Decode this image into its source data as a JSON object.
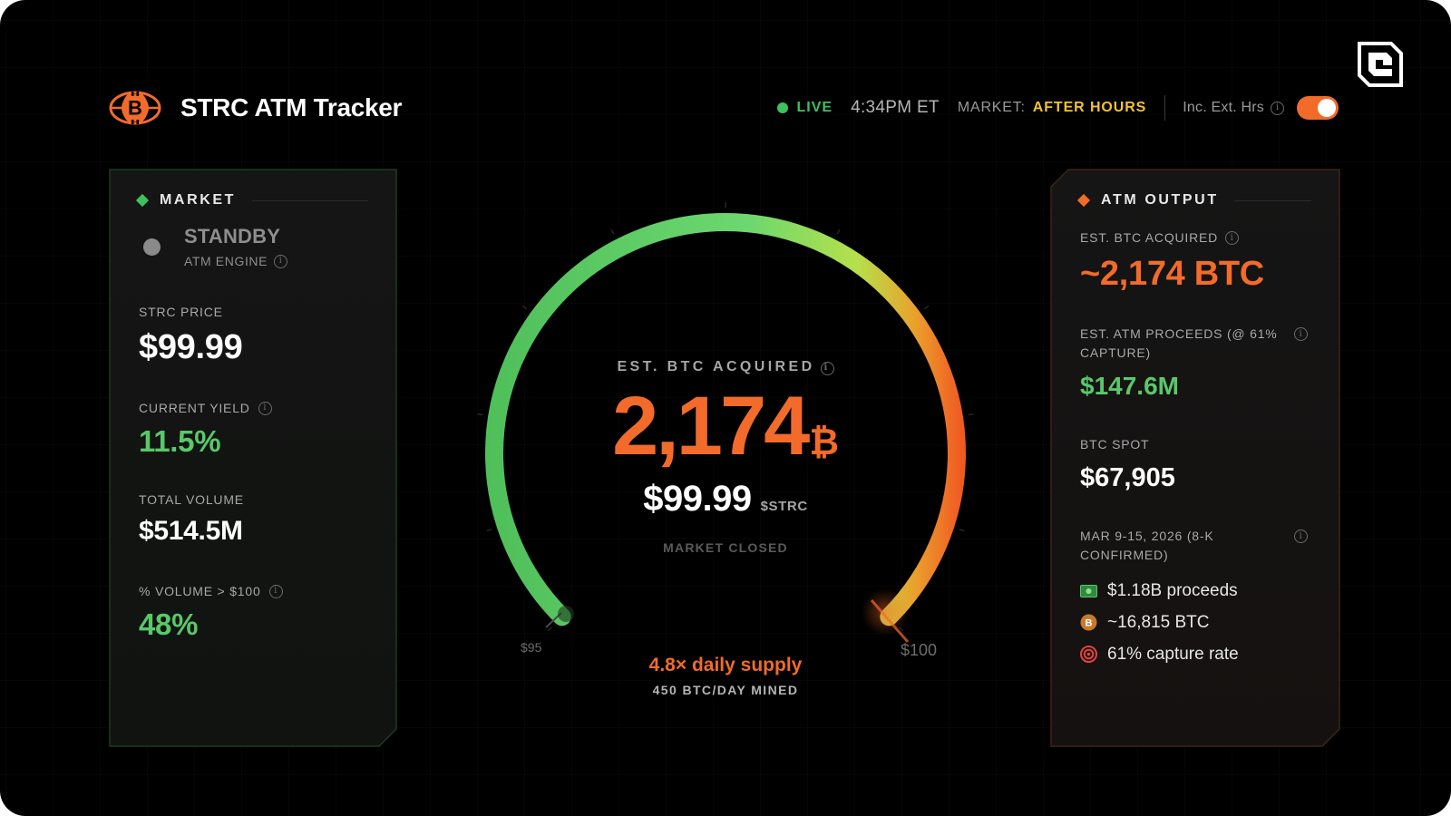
{
  "header": {
    "title": "STRC ATM Tracker",
    "live_label": "LIVE",
    "time": "4:34PM ET",
    "market_label": "MARKET:",
    "market_state": "AFTER HOURS",
    "ext_hours_label": "Inc. Ext. Hrs",
    "ext_hours_enabled": true
  },
  "left_panel": {
    "heading": "MARKET",
    "engine_state": "STANDBY",
    "engine_label": "ATM ENGINE",
    "metrics": [
      {
        "label": "STRC PRICE",
        "value": "$99.99"
      },
      {
        "label": "CURRENT YIELD",
        "value": "11.5%"
      },
      {
        "label": "TOTAL VOLUME",
        "value": "$514.5M"
      },
      {
        "label": "% VOLUME > $100",
        "value": "48%"
      }
    ]
  },
  "gauge": {
    "label": "EST. BTC ACQUIRED",
    "value": "2,174",
    "unit": "₿",
    "price": "$99.99",
    "ticker": "$STRC",
    "status": "MARKET CLOSED",
    "min_label": "$95",
    "max_label": "$100",
    "fill_fraction": 1.0,
    "supply_text": "4.8× daily supply",
    "mined_text": "450 BTC/DAY MINED"
  },
  "right_panel": {
    "heading": "ATM OUTPUT",
    "btc_label": "EST. BTC ACQUIRED",
    "btc_value": "~2,174 BTC",
    "proceeds_label": "EST. ATM PROCEEDS (@ 61% CAPTURE)",
    "proceeds_value": "$147.6M",
    "spot_label": "BTC SPOT",
    "spot_value": "$67,905",
    "week_label": "MAR 9-15, 2026 (8-K CONFIRMED)",
    "week_items": [
      {
        "icon": "cash-icon",
        "text": "$1.18B proceeds"
      },
      {
        "icon": "bitcoin-coin-icon",
        "text": "~16,815 BTC"
      },
      {
        "icon": "target-icon",
        "text": "61% capture rate"
      }
    ]
  },
  "colors": {
    "accent_orange": "#f26b2a",
    "accent_green": "#59c86a",
    "market_state": "#f2c233",
    "live": "#3ec15c"
  }
}
